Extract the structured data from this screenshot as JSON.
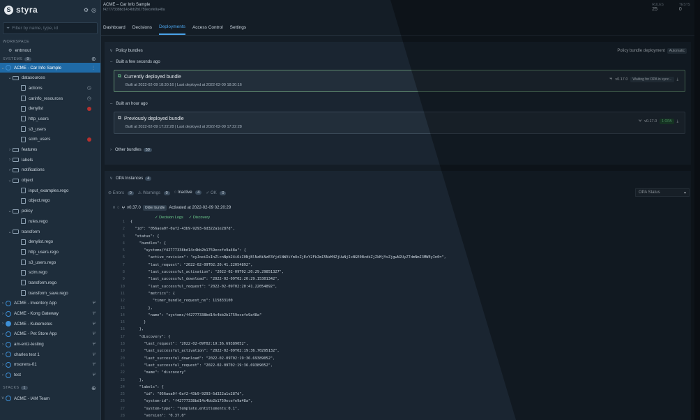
{
  "app": {
    "logo_letter": "S",
    "logo_text": "styra"
  },
  "sidebar": {
    "filter_placeholder": "Filter by name, type, id",
    "workspace_label": "WORKSPACE",
    "workspace_item": "entrnout",
    "systems_label": "SYSTEMS",
    "systems_count": "9",
    "tree": [
      {
        "label": "ACME - Car Info Sample",
        "level": 0,
        "kind": "system",
        "chev": "v",
        "selected": true
      },
      {
        "label": "datasources",
        "level": 1,
        "kind": "folder",
        "chev": "v"
      },
      {
        "label": "actions",
        "level": 2,
        "kind": "file",
        "mark": "clock"
      },
      {
        "label": "carinfo_resources",
        "level": 2,
        "kind": "file",
        "mark": "clock"
      },
      {
        "label": "denylist",
        "level": 2,
        "kind": "file",
        "mark": "red"
      },
      {
        "label": "http_users",
        "level": 2,
        "kind": "file"
      },
      {
        "label": "s3_users",
        "level": 2,
        "kind": "file"
      },
      {
        "label": "scim_users",
        "level": 2,
        "kind": "file",
        "mark": "red"
      },
      {
        "label": "features",
        "level": 1,
        "kind": "folder",
        "chev": ">"
      },
      {
        "label": "labels",
        "level": 1,
        "kind": "folder",
        "chev": ">"
      },
      {
        "label": "notifications",
        "level": 1,
        "kind": "folder",
        "chev": ">"
      },
      {
        "label": "object",
        "level": 1,
        "kind": "folder",
        "chev": "v"
      },
      {
        "label": "input_examples.rego",
        "level": 2,
        "kind": "file"
      },
      {
        "label": "object.rego",
        "level": 2,
        "kind": "file"
      },
      {
        "label": "policy",
        "level": 1,
        "kind": "folder",
        "chev": "v"
      },
      {
        "label": "rules.rego",
        "level": 2,
        "kind": "file"
      },
      {
        "label": "transform",
        "level": 1,
        "kind": "folder",
        "chev": "v"
      },
      {
        "label": "denylist.rego",
        "level": 2,
        "kind": "file"
      },
      {
        "label": "http_users.rego",
        "level": 2,
        "kind": "file"
      },
      {
        "label": "s3_users.rego",
        "level": 2,
        "kind": "file"
      },
      {
        "label": "scim.rego",
        "level": 2,
        "kind": "file"
      },
      {
        "label": "transform.rego",
        "level": 2,
        "kind": "file"
      },
      {
        "label": "transform_save.rego",
        "level": 2,
        "kind": "file"
      },
      {
        "label": "ACME - Inventory App",
        "level": 0,
        "kind": "system",
        "chev": ">",
        "mark": "icon"
      },
      {
        "label": "ACME - Kong Gateway",
        "level": 0,
        "kind": "system",
        "chev": ">",
        "mark": "icon"
      },
      {
        "label": "ACME - Kubernetes",
        "level": 0,
        "kind": "k8s",
        "chev": ">",
        "mark": "icon"
      },
      {
        "label": "ACME - Pet Store App",
        "level": 0,
        "kind": "system",
        "chev": ">",
        "mark": "icon"
      },
      {
        "label": "am-entz-testing",
        "level": 0,
        "kind": "system",
        "chev": ">",
        "mark": "icon"
      },
      {
        "label": "charles test 1",
        "level": 0,
        "kind": "system",
        "chev": ">",
        "mark": "icon"
      },
      {
        "label": "msorens-01",
        "level": 0,
        "kind": "system",
        "chev": ">",
        "mark": "icon"
      },
      {
        "label": "test",
        "level": 0,
        "kind": "system",
        "chev": ">",
        "mark": "icon"
      }
    ],
    "stacks_label": "STACKS",
    "stacks_count": "1",
    "stack_item": "ACME - IAM Team"
  },
  "header": {
    "title": "ACME – Car Info Sample",
    "subtitle": "f42777338bd14c4bb2b1759ecefe9a48a",
    "stats": [
      {
        "label": "RULES",
        "value": "25"
      },
      {
        "label": "TESTS",
        "value": "0"
      }
    ]
  },
  "tabs": [
    "Dashboard",
    "Decisions",
    "Deployments",
    "Access Control",
    "Settings"
  ],
  "active_tab": "Deployments",
  "bundles": {
    "header": "Policy bundles",
    "deployment_label": "Policy bundle deployment",
    "deployment_mode": "Automatic",
    "group1_label": "Built a few seconds ago",
    "current": {
      "title": "Currently deployed bundle",
      "sub": "Built at 2022-02-09 18:30:16  |  Last deployed at 2022-02-09 18:30:16",
      "version": "v0.17.0",
      "status": "Waiting for OPA in sync..."
    },
    "group2_label": "Built an hour ago",
    "previous": {
      "title": "Previously deployed bundle",
      "sub": "Built at 2022-02-09 17:22:28  |  Last deployed at 2022-02-09 17:22:28",
      "version": "v0.17.0",
      "status": "1 OPA"
    },
    "other_label": "Other bundles",
    "other_count": "50"
  },
  "opa": {
    "header": "OPA Instances",
    "count": "4",
    "filters": [
      {
        "label": "Errors",
        "count": "0"
      },
      {
        "label": "Warnings",
        "count": "0"
      },
      {
        "label": "Inactive",
        "count": "4"
      },
      {
        "label": "OK",
        "count": "0"
      }
    ],
    "status_select": "OPA Status",
    "instance_version": "v0.37.0",
    "instance_badge": "Older bundle",
    "instance_activated": "Activated at 2022-02-09 02:20:29",
    "instance_tags": [
      "Decision Logs",
      "Discovery"
    ]
  },
  "code_lines": [
    "{",
    "  \"id\": \"056aea0f-0af2-43b9-9293-6d322a1e287d\",",
    "  \"status\": {",
    "    \"bundles\": {",
    "      \"systems/f42777338bd14c4bb2b1759ecefe9a48a\": {",
    "        \"active_revision\": \"eyJoeiIsInZlcnNpb24iOiI0NjBlNzBiNzE3YjdlNWViYmUxZjEzY2FkZmI5NzM4ZjUwNjIxNGE0NzdkZjZkMjYxZjgwN2UyZTdmNmI3MWEyIn0=\",",
    "        \"last_request\": \"2022-02-09T02:20:41.22054892\",",
    "        \"last_successful_activation\": \"2022-02-09T02:20:29.29851327\",",
    "        \"last_successful_download\": \"2022-02-09T02:20:29.15301342\",",
    "        \"last_successful_request\": \"2022-02-09T02:20:41.22054892\",",
    "        \"metrics\": {",
    "          \"timer_bundle_request_ns\": 115833100",
    "        },",
    "        \"name\": \"systems/f42777338bd14c4bb2b1759ecefe9a48a\"",
    "      }",
    "    },",
    "    \"discovery\": {",
    "      \"last_request\": \"2022-02-09T02:19:36.69389052\",",
    "      \"last_successful_activation\": \"2022-02-09T02:19:36.70295132\",",
    "      \"last_successful_download\": \"2022-02-09T02:19:36.69389052\",",
    "      \"last_successful_request\": \"2022-02-09T02:19:36.69389052\",",
    "      \"name\": \"discovery\"",
    "    },",
    "    \"labels\": {",
    "      \"id\": \"056aea0f-0af2-43b9-9293-6d322a1e287d\",",
    "      \"system-id\": \"f42777338bd14c4bb2b1759ecefe9a48a\",",
    "      \"system-type\": \"template.entitlements:0.1\",",
    "      \"version\": \"0.37.0\""
  ],
  "colors": {
    "accent": "#4aa3ea",
    "selected": "#1f6aa6",
    "sidebar": "#1e2d3b",
    "main": "#141d26"
  }
}
